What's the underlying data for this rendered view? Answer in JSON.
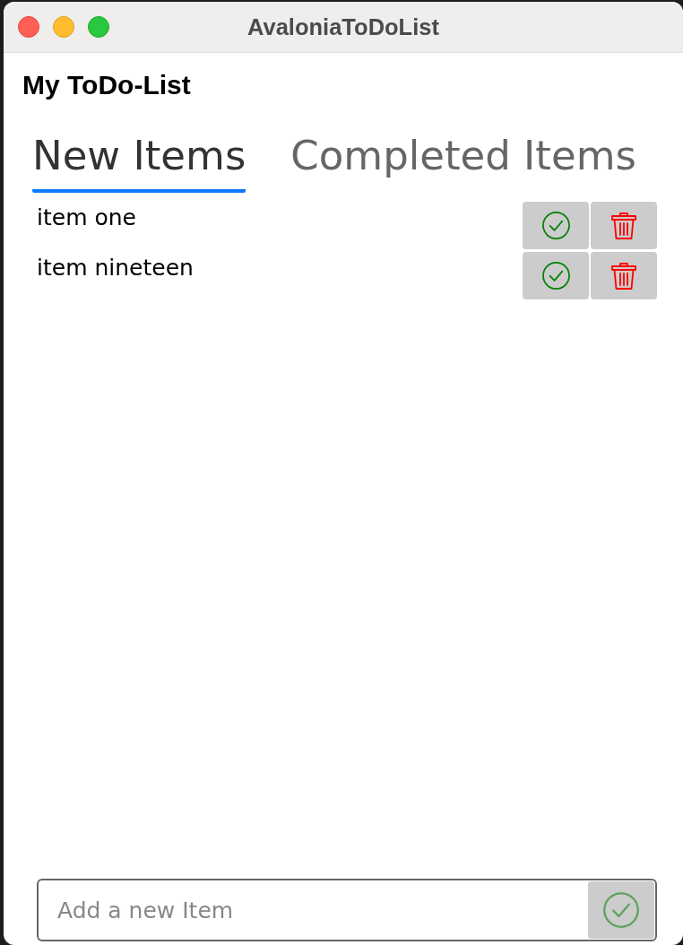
{
  "window": {
    "title": "AvaloniaToDoList"
  },
  "heading": "My ToDo-List",
  "tabs": [
    {
      "label": "New Items",
      "selected": true
    },
    {
      "label": "Completed Items",
      "selected": false
    }
  ],
  "items": [
    {
      "text": "item one"
    },
    {
      "text": "item nineteen"
    }
  ],
  "new_item": {
    "placeholder": "Add a new Item",
    "submit_disabled": true
  }
}
